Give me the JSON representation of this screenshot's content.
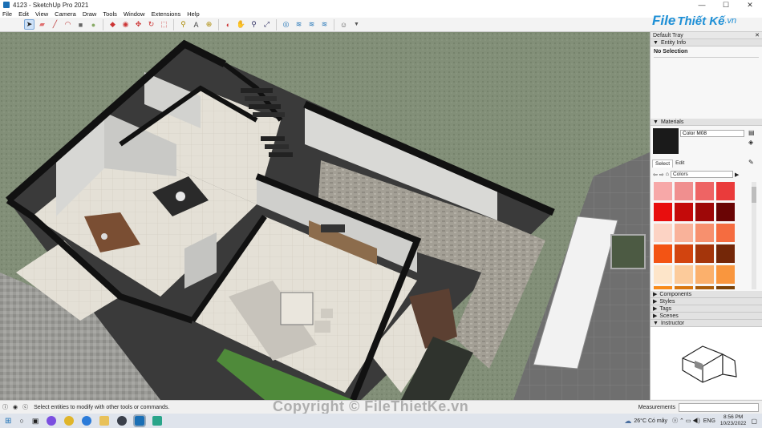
{
  "window": {
    "title": "4123 - SketchUp Pro 2021",
    "minimize_glyph": "—",
    "maximize_glyph": "☐",
    "close_glyph": "✕"
  },
  "menu": [
    "File",
    "Edit",
    "View",
    "Camera",
    "Draw",
    "Tools",
    "Window",
    "Extensions",
    "Help"
  ],
  "logo": {
    "brand": "File",
    "brand2": "Thiết Kế",
    "suffix": ".vn"
  },
  "tray": {
    "title": "Default Tray",
    "entity_info": {
      "label": "Entity Info",
      "value": "No Selection"
    },
    "materials": {
      "label": "Materials",
      "current": "Color M08",
      "tabs": [
        "Select",
        "Edit"
      ],
      "library": "Colors",
      "swatches": [
        "#f7a8a8",
        "#f08f8f",
        "#ee6464",
        "#ea3b3b",
        "#e80e0e",
        "#c40a0a",
        "#9e0808",
        "#6a0505",
        "#fcd3c4",
        "#f9b29a",
        "#f7906e",
        "#f56c40",
        "#f35414",
        "#d2440f",
        "#a4350b",
        "#742708",
        "#fde5c9",
        "#fccb9b",
        "#fbb06c",
        "#f9963e",
        "#f88b1a",
        "#d9760f",
        "#a95c0b",
        "#7a4208"
      ]
    },
    "collapsed": [
      "Components",
      "Styles",
      "Tags",
      "Scenes"
    ],
    "instructor": "Instructor"
  },
  "status": {
    "hint": "Select entities to modify with other tools or commands.",
    "measurements": "Measurements"
  },
  "watermark": "Copyright © FileThietKe.vn",
  "taskbar": {
    "weather": "26°C Có mây",
    "lang": "ENG",
    "time": "8:56 PM",
    "date": "10/23/2022"
  }
}
